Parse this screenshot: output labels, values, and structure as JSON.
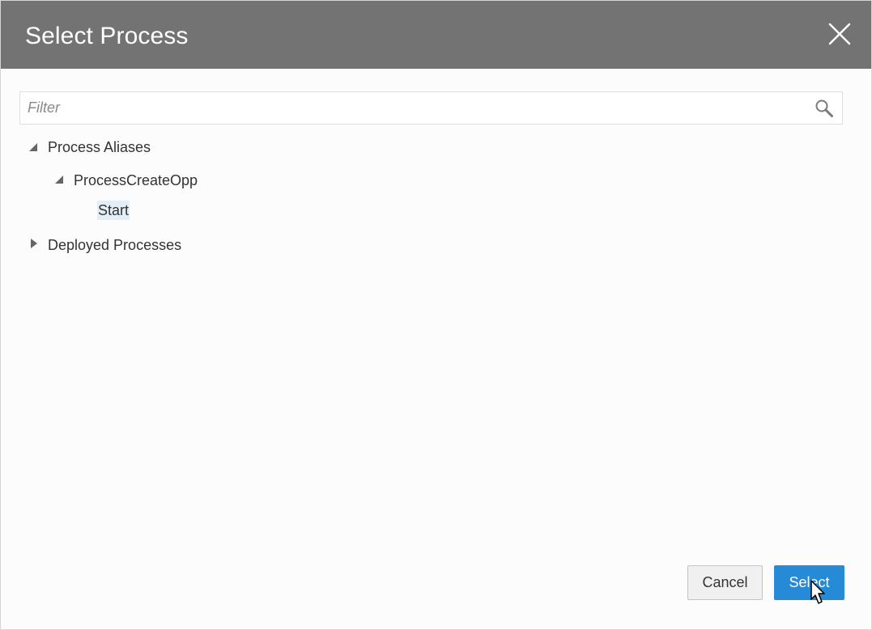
{
  "dialog": {
    "title": "Select Process",
    "close_icon": "close-icon"
  },
  "filter": {
    "placeholder": "Filter",
    "value": "",
    "icon": "search-icon"
  },
  "tree": {
    "nodes": [
      {
        "label": "Process Aliases",
        "expanded": true,
        "level": 0
      },
      {
        "label": "ProcessCreateOpp",
        "expanded": true,
        "level": 1
      },
      {
        "label": "Start",
        "selected": true,
        "level": 2
      },
      {
        "label": "Deployed Processes",
        "expanded": false,
        "level": 0
      }
    ]
  },
  "footer": {
    "cancel_label": "Cancel",
    "select_label": "Select"
  },
  "colors": {
    "header_bg": "#737373",
    "primary": "#268ad6",
    "selected_bg": "#e3eef7"
  }
}
